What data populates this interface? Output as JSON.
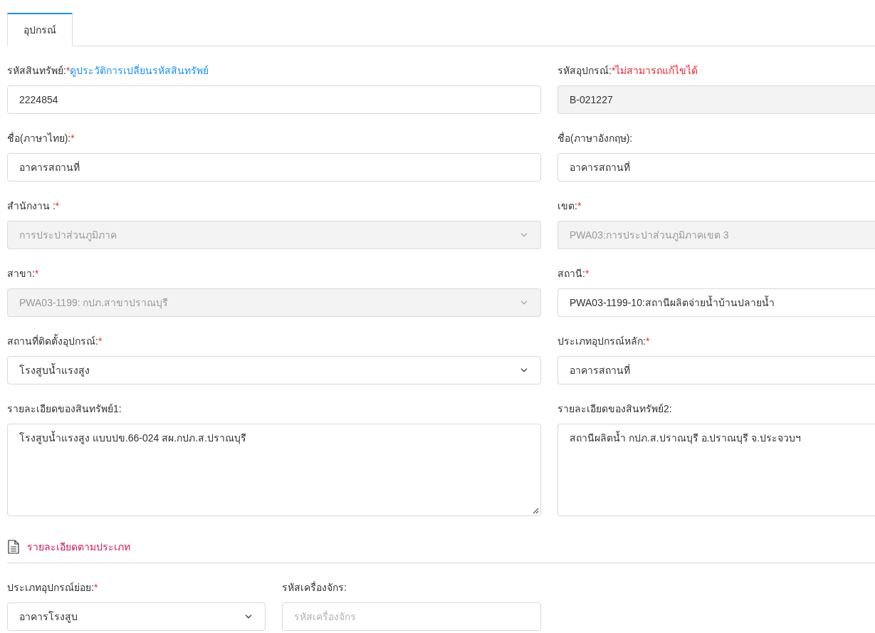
{
  "tabs": [
    {
      "label": "อุปกรณ์",
      "selected": true
    }
  ],
  "main_fields": [
    {
      "label": "รหัสสินทรัพย์:",
      "required_mark": "*",
      "note": {
        "kind": "link",
        "text": "ดูประวัติการเปลี่ยนรหัสสินทรัพย์"
      },
      "kind": "input",
      "value": "2224854",
      "disabled": false,
      "readonly": false
    },
    {
      "label": "รหัสอุปกรณ์:",
      "required_mark": "*",
      "note": {
        "kind": "warning",
        "text": "ไม่สามารถแก้ไขได้"
      },
      "kind": "input",
      "value": "B-021227",
      "disabled": false,
      "readonly": true
    },
    {
      "label": "ชื่อ(ภาษาไทย):",
      "required_mark": "*",
      "kind": "input",
      "value": "อาคารสถานที่",
      "disabled": false,
      "readonly": false
    },
    {
      "label": "ชื่อ(ภาษาอังกฤษ):",
      "kind": "input",
      "value": "อาคารสถานที่",
      "disabled": false,
      "readonly": false
    },
    {
      "label": "สำนักงาน :",
      "required_mark": "*",
      "kind": "select",
      "value": "การประปาส่วนภูมิภาค",
      "disabled": true
    },
    {
      "label": "เขต:",
      "required_mark": "*",
      "kind": "input",
      "value": "PWA03:การประปาส่วนภูมิภาคเขต 3",
      "disabled": true
    },
    {
      "label": "สาขา:",
      "required_mark": "*",
      "kind": "select",
      "value": "PWA03-1199: กปภ.สาขาปราณบุรี",
      "disabled": true
    },
    {
      "label": "สถานี:",
      "required_mark": "*",
      "kind": "input",
      "value": "PWA03-1199-10:สถานีผลิตจ่ายน้ำบ้านปลายน้ำ",
      "disabled": false,
      "readonly": false
    },
    {
      "label": "สถานที่ติดตั้งอุปกรณ์:",
      "required_mark": "*",
      "kind": "select",
      "value": "โรงสูบน้ำแรงสูง",
      "disabled": false,
      "readonly": false
    },
    {
      "label": "ประเภทอุปกรณ์หลัก:",
      "required_mark": "*",
      "kind": "input",
      "value": "อาคารสถานที่",
      "disabled": false,
      "readonly": false
    },
    {
      "label": "รายละเอียดของสินทรัพย์1:",
      "kind": "textarea",
      "value": "โรงสูบน้ำแรงสูง แบบปข.66-024 สผ.กปภ.ส.ปราณบุรี",
      "disabled": false,
      "readonly": false,
      "resizable": true
    },
    {
      "label": "รายละเอียดของสินทรัพย์2:",
      "kind": "textarea",
      "value": "สถานีผลิตน้ำ กปภ.ส.ปราณบุรี อ.ปราณบุรี จ.ประจวบฯ",
      "disabled": false,
      "readonly": false,
      "resizable": false
    }
  ],
  "section": {
    "title": "รายละเอียดตามประเภท"
  },
  "type_fields": [
    {
      "label": "ประเภทอุปกรณ์ย่อย:",
      "required_mark": "*",
      "kind": "select",
      "value": "อาคารโรงสูบ",
      "disabled": false,
      "readonly": false
    },
    {
      "label": "รหัสเครื่องจักร:",
      "kind": "input",
      "placeholder": "รหัสเครื่องจักร",
      "disabled": false,
      "readonly": false
    }
  ]
}
